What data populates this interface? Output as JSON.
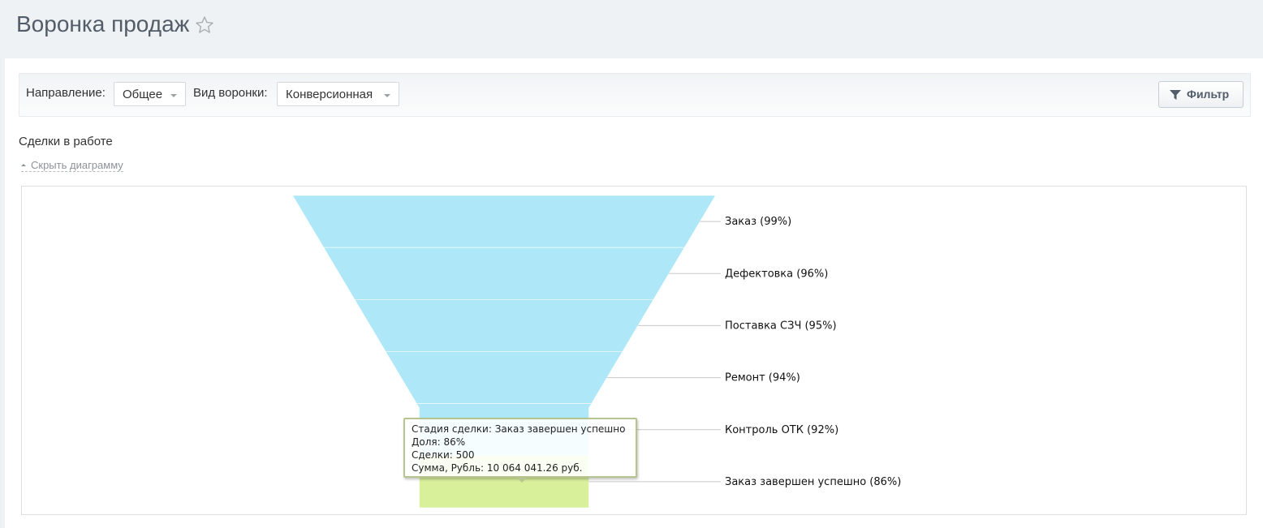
{
  "header": {
    "title": "Воронка продаж"
  },
  "toolbar": {
    "direction_label": "Направление:",
    "direction_value": "Общее",
    "funnel_type_label": "Вид воронки:",
    "funnel_type_value": "Конверсионная",
    "filter_label": "Фильтр"
  },
  "section": {
    "title": "Сделки в работе",
    "hide_link": "Скрыть диаграмму"
  },
  "colors": {
    "funnel": "#aee8f8",
    "highlight": "#d9f09b",
    "leader": "#c8c8c8"
  },
  "chart_data": {
    "type": "funnel",
    "stages": [
      {
        "label": "Заказ (99%)",
        "value": 99
      },
      {
        "label": "Дефектовка (96%)",
        "value": 96
      },
      {
        "label": "Поставка СЗЧ (95%)",
        "value": 95
      },
      {
        "label": "Ремонт (94%)",
        "value": 94
      },
      {
        "label": "Контроль ОТК (92%)",
        "value": 92
      },
      {
        "label": "Заказ завершен успешно (86%)",
        "value": 86
      }
    ],
    "highlighted_index": 5,
    "tooltip": {
      "stage": "Стадия сделки: Заказ завершен успешно",
      "share": "Доля: 86%",
      "deals": "Сделки: 500",
      "sum": "Сумма, Рубль: 10 064 041.26 руб."
    }
  }
}
